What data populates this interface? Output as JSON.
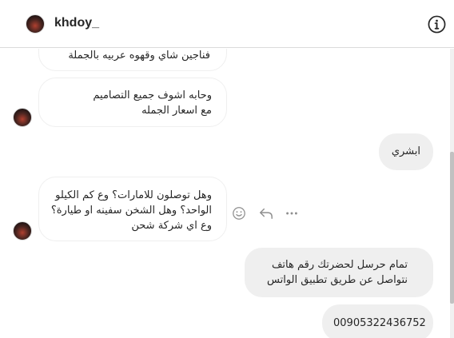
{
  "header": {
    "username": "khdoy_",
    "info_icon": "info-icon",
    "avatar_icon": "profile-avatar"
  },
  "messages": [
    {
      "direction": "incoming",
      "text": "فناجين شاي وقهوه عربيه بالجملة"
    },
    {
      "direction": "incoming",
      "text": "وحابه اشوف جميع التصاميم مع اسعار الجمله"
    },
    {
      "direction": "outgoing",
      "text": "ابشري"
    },
    {
      "direction": "incoming",
      "text": "وهل توصلون للامارات؟ وع كم الكيلو الواحد؟ وهل الشخن سفينه او طيارة؟ وع اي شركة شحن"
    },
    {
      "direction": "outgoing",
      "text": "تمام حرسل لحضرتك رقم هاتف نتواصل عن طريق تطبيق الواتس"
    },
    {
      "direction": "outgoing",
      "text": "00905322436752"
    }
  ],
  "message_actions": [
    "emoji-icon",
    "reply-icon",
    "more-options-icon"
  ]
}
